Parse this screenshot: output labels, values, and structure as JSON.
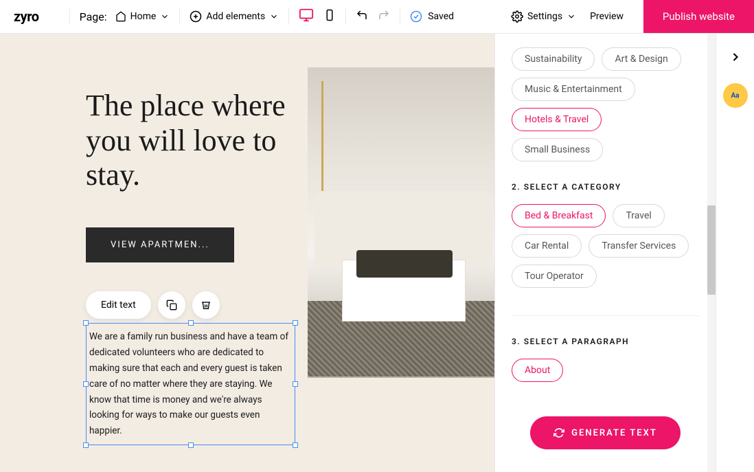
{
  "topbar": {
    "logo": "zyro",
    "page_label": "Page:",
    "page_name": "Home",
    "add_elements": "Add elements",
    "saved": "Saved",
    "settings": "Settings",
    "preview": "Preview",
    "publish": "Publish website"
  },
  "canvas": {
    "headline": "The place where you will love to stay.",
    "cta": "VIEW APARTMEN...",
    "edit_text_btn": "Edit text",
    "selected_paragraph": "We are a family run business and have a team of dedicated volunteers who are dedicated to making sure that each and every guest is taken care of no matter where they are staying. We know that time is money and we're always looking for ways to make our guests even happier."
  },
  "panel": {
    "topic_chips": [
      {
        "label": "Sustainability",
        "selected": false
      },
      {
        "label": "Art & Design",
        "selected": false
      },
      {
        "label": "Music & Entertainment",
        "selected": false
      },
      {
        "label": "Hotels & Travel",
        "selected": true
      },
      {
        "label": "Small Business",
        "selected": false
      }
    ],
    "section2_header": "2. SELECT A CATEGORY",
    "category_chips": [
      {
        "label": "Bed & Breakfast",
        "selected": true
      },
      {
        "label": "Travel",
        "selected": false
      },
      {
        "label": "Car Rental",
        "selected": false
      },
      {
        "label": "Transfer Services",
        "selected": false
      },
      {
        "label": "Tour Operator",
        "selected": false
      }
    ],
    "section3_header": "3. SELECT A PARAGRAPH",
    "paragraph_chips": [
      {
        "label": "About",
        "selected": true
      }
    ],
    "generate_btn": "GENERATE TEXT"
  },
  "rail": {
    "ai_badge": "Aa"
  }
}
